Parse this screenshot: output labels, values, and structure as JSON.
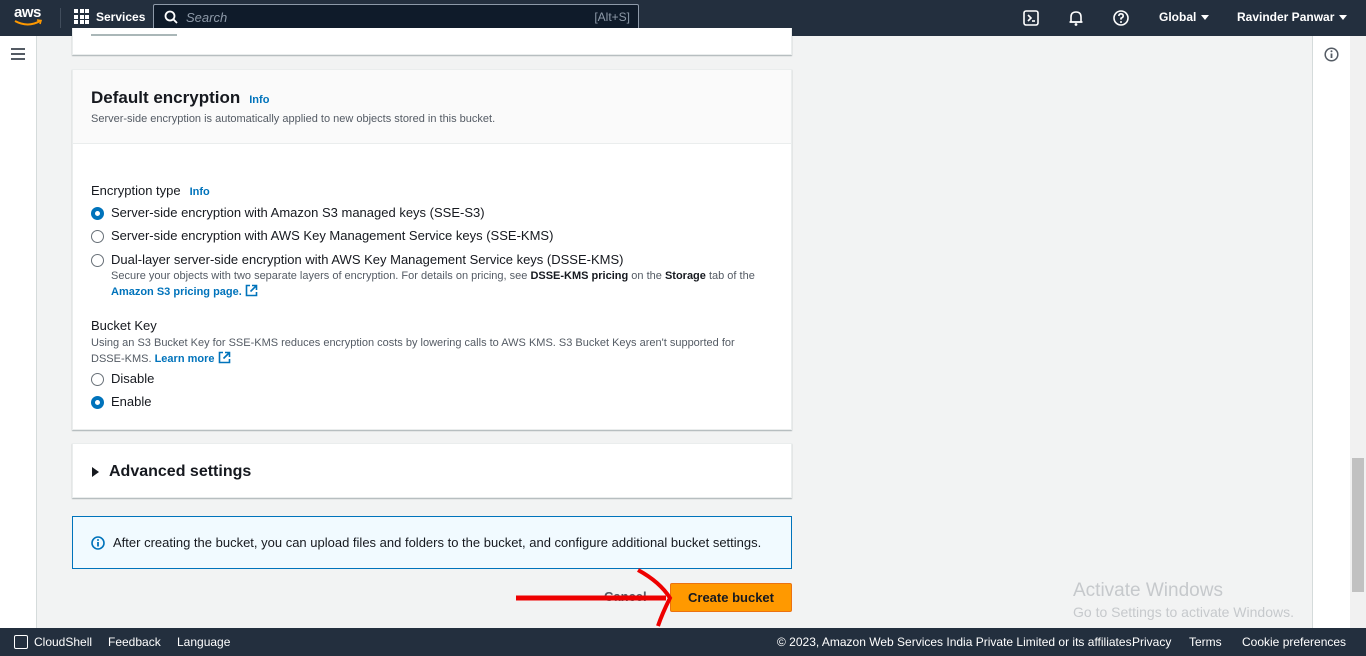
{
  "nav": {
    "logo": "aws",
    "services": "Services",
    "search_placeholder": "Search",
    "search_shortcut": "[Alt+S]",
    "region": "Global",
    "user": "Ravinder Panwar"
  },
  "encryption": {
    "title": "Default encryption",
    "info": "Info",
    "description": "Server-side encryption is automatically applied to new objects stored in this bucket.",
    "type_label": "Encryption type",
    "type_info": "Info",
    "options": [
      {
        "label": "Server-side encryption with Amazon S3 managed keys (SSE-S3)",
        "selected": true
      },
      {
        "label": "Server-side encryption with AWS Key Management Service keys (SSE-KMS)",
        "selected": false
      },
      {
        "label": "Dual-layer server-side encryption with AWS Key Management Service keys (DSSE-KMS)",
        "selected": false
      }
    ],
    "dsse_note_1": "Secure your objects with two separate layers of encryption. For details on pricing, see ",
    "dsse_note_bold1": "DSSE-KMS pricing",
    "dsse_note_2": " on the ",
    "dsse_note_bold2": "Storage",
    "dsse_note_3": " tab of the ",
    "dsse_link": "Amazon S3 pricing page.",
    "bucket_key_label": "Bucket Key",
    "bucket_key_desc": "Using an S3 Bucket Key for SSE-KMS reduces encryption costs by lowering calls to AWS KMS. S3 Bucket Keys aren't supported for DSSE-KMS. ",
    "learn_more": "Learn more",
    "bucket_options": [
      {
        "label": "Disable",
        "selected": false
      },
      {
        "label": "Enable",
        "selected": true
      }
    ]
  },
  "advanced": {
    "title": "Advanced settings"
  },
  "alert": {
    "text": "After creating the bucket, you can upload files and folders to the bucket, and configure additional bucket settings."
  },
  "actions": {
    "cancel": "Cancel",
    "create": "Create bucket"
  },
  "watermark": {
    "line1": "Activate Windows",
    "line2": "Go to Settings to activate Windows."
  },
  "footer": {
    "cloudshell": "CloudShell",
    "feedback": "Feedback",
    "language": "Language",
    "copyright": "© 2023, Amazon Web Services India Private Limited or its affiliates.",
    "privacy": "Privacy",
    "terms": "Terms",
    "cookies": "Cookie preferences"
  },
  "colors": {
    "accent": "#0073bb",
    "primary_button": "#ff9900",
    "nav_bg": "#232f3e",
    "annotation": "#ee0000"
  }
}
